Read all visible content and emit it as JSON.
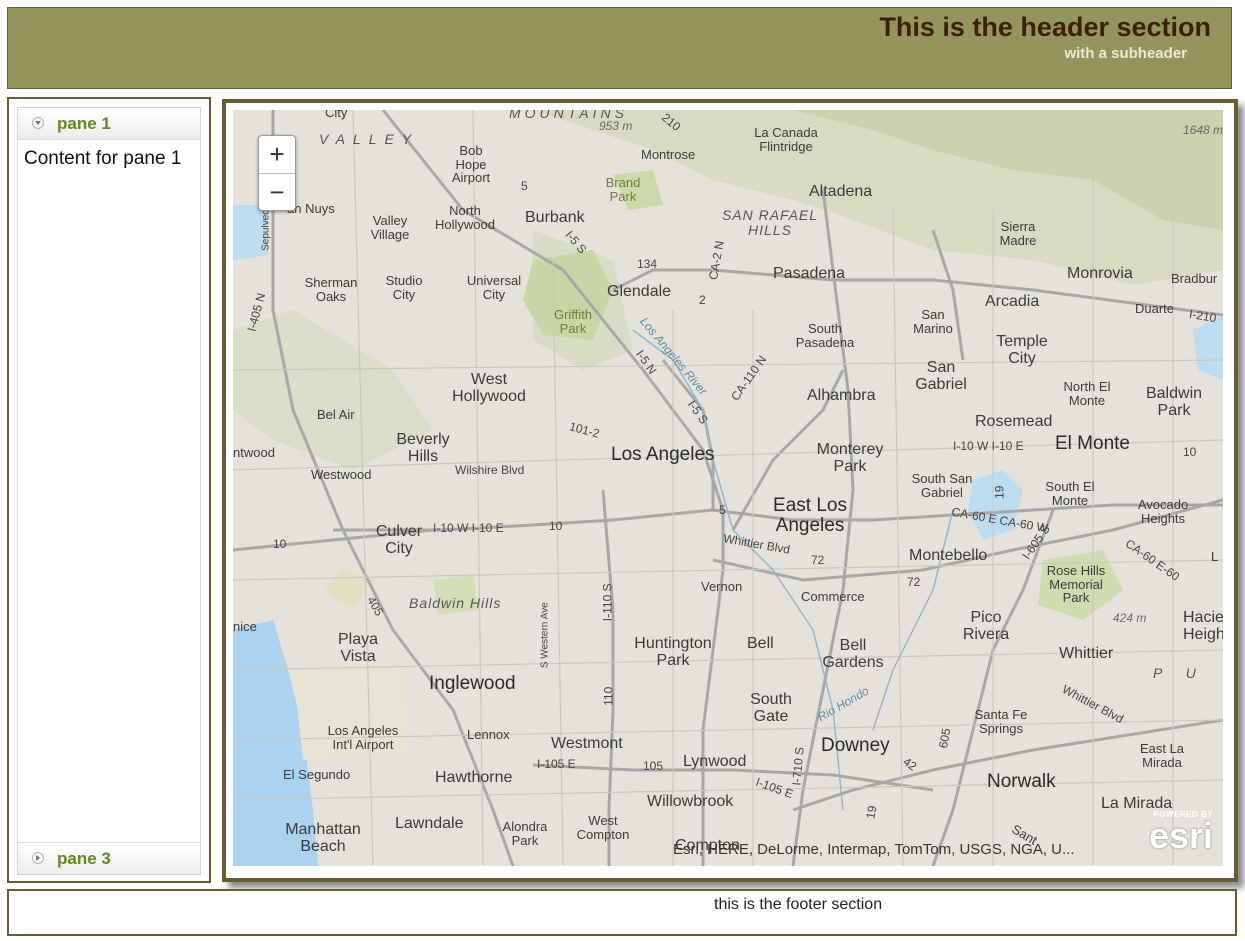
{
  "header": {
    "title": "This is the header section",
    "subtitle": "with a subheader"
  },
  "accordion": {
    "panes": [
      {
        "label": "pane 1",
        "content": "Content for pane 1",
        "expanded": true
      },
      {
        "label": "pane 3",
        "expanded": false
      }
    ]
  },
  "map": {
    "zoom_in": "+",
    "zoom_out": "−",
    "attribution": "Esri, HERE, DeLorme, Intermap, TomTom, USGS, NGA, U...",
    "logo_powered": "POWERED BY",
    "logo_word": "esri",
    "labels": {
      "los_angeles": "Los Angeles",
      "burbank": "Burbank",
      "glendale": "Glendale",
      "pasadena": "Pasadena",
      "altadena": "Altadena",
      "la_canada": "La Canada Flintridge",
      "montrose": "Montrose",
      "arcadia": "Arcadia",
      "monrovia": "Monrovia",
      "sierra_madre": "Sierra Madre",
      "duarte": "Duarte",
      "bradbury": "Bradbur",
      "san_marino": "San Marino",
      "south_pasadena": "South Pasadena",
      "temple_city": "Temple City",
      "san_gabriel": "San Gabriel",
      "alhambra": "Alhambra",
      "rosemead": "Rosemead",
      "north_el_monte": "North El Monte",
      "baldwin_park": "Baldwin Park",
      "el_monte": "El Monte",
      "monterey_park": "Monterey Park",
      "south_san_gabriel": "South San Gabriel",
      "south_el_monte": "South El Monte",
      "avocado_heights": "Avocado Heights",
      "east_los_angeles": "East Los Angeles",
      "montebello": "Montebello",
      "rose_hills": "Rose Hills Memorial Park",
      "commerce": "Commerce",
      "vernon": "Vernon",
      "pico_rivera": "Pico Rivera",
      "whittier": "Whittier",
      "hacienda": "Hacier Heigh",
      "bell": "Bell",
      "bell_gardens": "Bell Gardens",
      "huntington_park": "Huntington Park",
      "south_gate": "South Gate",
      "downey": "Downey",
      "santa_fe_springs": "Santa Fe Springs",
      "east_la_mirada": "East La Mirada",
      "norwalk": "Norwalk",
      "la_mirada": "La Mirada",
      "lynwood": "Lynwood",
      "willowbrook": "Willowbrook",
      "west_compton": "West Compton",
      "compton": "Compton",
      "westmont": "Westmont",
      "lennox": "Lennox",
      "inglewood": "Inglewood",
      "hawthorne": "Hawthorne",
      "lawndale": "Lawndale",
      "alondra_park": "Alondra Park",
      "el_segundo": "El Segundo",
      "manhattan_beach": "Manhattan Beach",
      "lax": "Los Angeles Int'l Airport",
      "playa_vista": "Playa Vista",
      "venice": "nice",
      "culver_city": "Culver City",
      "baldwin_hills": "Baldwin Hills",
      "westwood": "Westwood",
      "brentwood": "ntwood",
      "bel_air": "Bel Air",
      "beverly_hills": "Beverly Hills",
      "west_hollywood": "West Hollywood",
      "sherman_oaks": "Sherman Oaks",
      "studio_city": "Studio City",
      "universal_city": "Universal City",
      "valley_village": "Valley Village",
      "north_hollywood": "North Hollywood",
      "van_nuys": "an Nuys",
      "bob_hope": "Bob Hope Airport",
      "griffith_park": "Griffith Park",
      "brand_park": "Brand Park",
      "san_rafael_hills": "SAN RAFAEL HILLS",
      "valley": "VALLEY",
      "mountains": "MOUNTAINS",
      "city_top": "City",
      "puente": "P U",
      "elev_953": "953 m",
      "elev_1648": "1648 m",
      "elev_424": "424 m",
      "wilshire": "Wilshire Blvd",
      "whittier_blvd": "Whittier Blvd",
      "whittier_blvd2": "Whittier Blvd",
      "la_river": "Los Angeles River",
      "rio_hondo": "Rio Hondo",
      "i10_west": "I-10 W  I-10 E",
      "i10_east": "I-10 W  I-10 E",
      "i105": "I-105 E",
      "i105b": "I-105 E",
      "i110": "I-110 S",
      "ca110": "CA-110 N",
      "i605": "I-605 S",
      "ca60": "CA-60 E   CA-60 W",
      "ca60b": "CA-60 E-60",
      "i5s": "I-5 S",
      "i5n": "I-5 N",
      "i5s2": "I-5 S",
      "i405": "I-405 N",
      "ca2": "CA-2 N",
      "i210": "I-210",
      "i710": "I-710 S",
      "r101": "101-2",
      "r134": "134",
      "r210": "210",
      "r405": "405",
      "r10": "10",
      "r10b": "10",
      "r10c": "10",
      "r5": "5",
      "r5b": "5",
      "r72": "72",
      "r72b": "72",
      "r605": "605",
      "r105": "105",
      "r110": "110",
      "r19": "19",
      "r19b": "19",
      "r42": "42",
      "r2": "2",
      "sepulveda": "Sepulveda",
      "western_ave": "S Western Ave",
      "santa_fe": "Sant",
      "l_edge": "L"
    }
  },
  "footer": {
    "text": "this is the footer section"
  }
}
